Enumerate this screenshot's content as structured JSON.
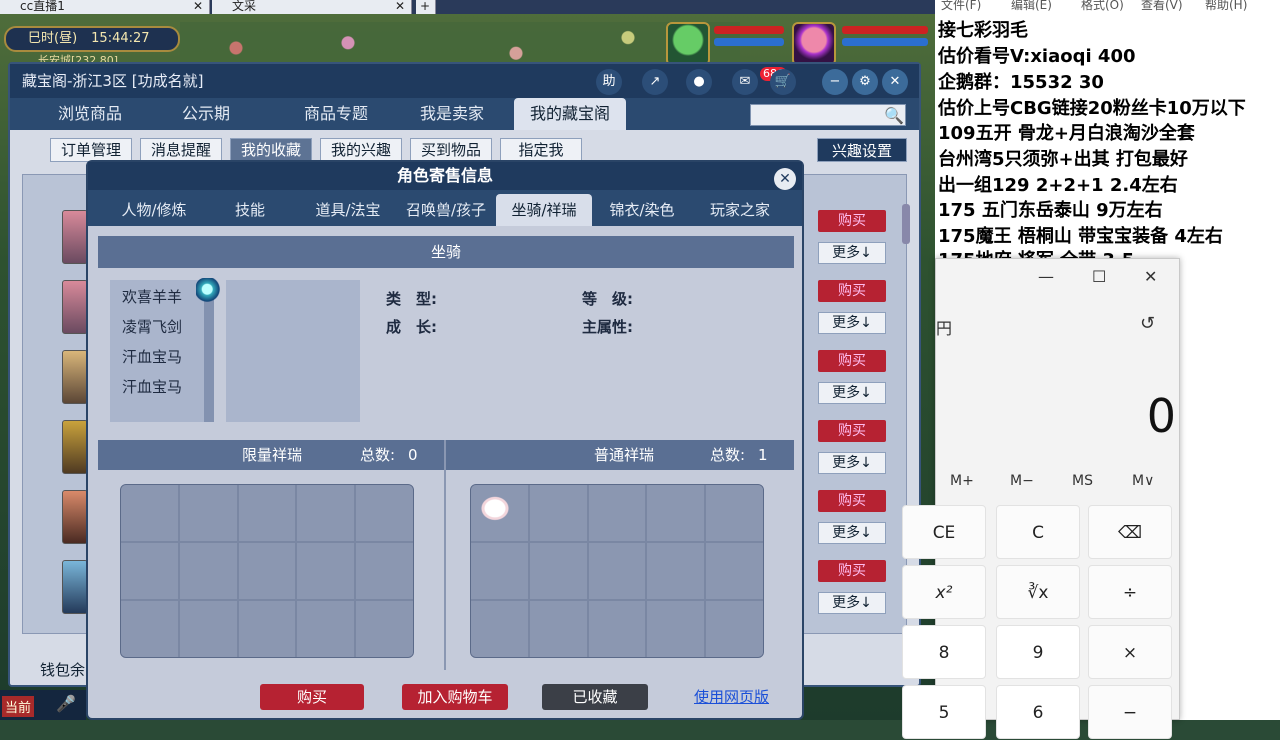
{
  "browser": {
    "tabs": [
      {
        "label": "cc直播1"
      },
      {
        "label": "文采"
      }
    ],
    "new_tab": "+"
  },
  "game_hud": {
    "clock_period": "巳时(昼)",
    "clock_time": "15:44:27",
    "location": "长安城[232,80]"
  },
  "trade_window": {
    "title": "藏宝阁-浙江3区 [功成名就]",
    "title_icons": [
      "助",
      "↗",
      "●"
    ],
    "message_badge": "686",
    "nav_tabs": [
      "浏览商品",
      "公示期",
      "商品专题",
      "我是卖家",
      "我的藏宝阁"
    ],
    "active_nav": "我的藏宝阁",
    "sub_tabs": [
      "订单管理",
      "消息提醒",
      "我的收藏",
      "我的兴趣",
      "买到物品",
      "指定我"
    ],
    "active_sub": "我的收藏",
    "interest_settings": "兴趣设置",
    "buy_label": "购买",
    "more_label": "更多↓",
    "wallet_label": "钱包余"
  },
  "modal": {
    "title": "角色寄售信息",
    "tabs": [
      "人物/修炼",
      "技能",
      "道具/法宝",
      "召唤兽/孩子",
      "坐骑/祥瑞",
      "锦衣/染色",
      "玩家之家"
    ],
    "active_tab": "坐骑/祥瑞",
    "mount_header": "坐骑",
    "mounts": [
      "欢喜羊羊",
      "凌霄飞剑",
      "汗血宝马",
      "汗血宝马"
    ],
    "attributes": {
      "type_label": "类　型:",
      "level_label": "等　级:",
      "growth_label": "成　长:",
      "main_attr_label": "主属性:"
    },
    "limited_xiangrui": {
      "title": "限量祥瑞",
      "total_label": "总数:",
      "total": "0"
    },
    "normal_xiangrui": {
      "title": "普通祥瑞",
      "total_label": "总数:",
      "total": "1"
    },
    "buttons": {
      "buy": "购买",
      "add_cart": "加入购物车",
      "favorited": "已收藏",
      "web_version": "使用网页版"
    }
  },
  "bottom_bar": {
    "label": "当前"
  },
  "right_panel": {
    "menu": [
      "文件(F)",
      "编辑(E)",
      "格式(O)",
      "查看(V)",
      "帮助(H)"
    ],
    "lines": [
      "   接七彩羽毛",
      "估价看号V:xiaoqi 400",
      "企鹅群：15532 30",
      "估价上号CBG链接20粉丝卡10万以下",
      "109五开 骨龙+月白浪淘沙全套",
      "台州湾5只须弥+出其 打包最好",
      "出一组129 2+2+1    2.4左右",
      "175 五门东岳泰山  9万左右",
      "175魔王 梧桐山  带宝宝装备 4左右",
      "175地府 将军  全带 3.5"
    ]
  },
  "calculator": {
    "mode_fragment": "円",
    "display": "0",
    "memory_keys": [
      "M+",
      "M−",
      "MS",
      "M∨"
    ],
    "keys": [
      [
        "CE",
        "C",
        "⌫"
      ],
      [
        "x²",
        "∛x",
        "÷"
      ],
      [
        "8",
        "9",
        "×"
      ],
      [
        "5",
        "6",
        "−"
      ]
    ]
  }
}
